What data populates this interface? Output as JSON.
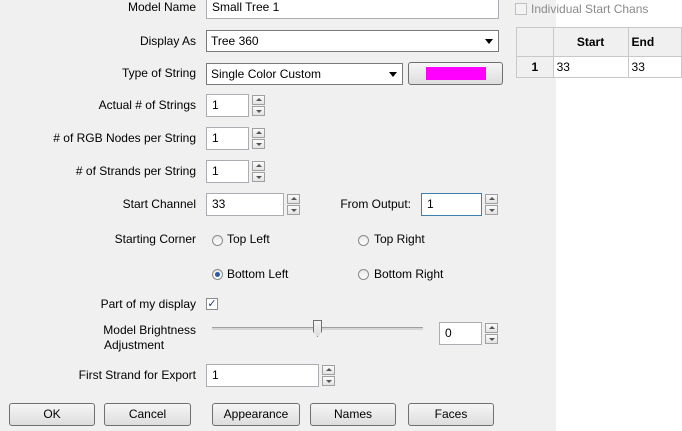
{
  "model_name": {
    "label": "Model Name",
    "value": "Small Tree 1"
  },
  "individual_start_chans": {
    "label": "Individual Start Chans",
    "checked": false,
    "enabled": false
  },
  "display_as": {
    "label": "Display As",
    "value": "Tree 360"
  },
  "type_of_string": {
    "label": "Type of String",
    "value": "Single Color Custom",
    "color": "#ff00ff"
  },
  "actual_strings": {
    "label": "Actual # of Strings",
    "value": "1"
  },
  "rgb_nodes": {
    "label": "# of RGB Nodes per String",
    "value": "1"
  },
  "strands": {
    "label": "# of Strands per String",
    "value": "1"
  },
  "start_channel": {
    "label": "Start Channel",
    "value": "33"
  },
  "from_output": {
    "label": "From Output:",
    "value": "1"
  },
  "starting_corner": {
    "label": "Starting Corner",
    "options": [
      "Top Left",
      "Top Right",
      "Bottom Left",
      "Bottom Right"
    ],
    "selected": "Bottom Left"
  },
  "part_of_display": {
    "label": "Part of my display",
    "checked": true
  },
  "brightness": {
    "label_line1": "Model Brightness",
    "label_line2": "Adjustment",
    "value": "0",
    "level_fraction": 0.5
  },
  "first_strand_export": {
    "label": "First Strand for Export",
    "value": "1"
  },
  "buttons": {
    "ok": "OK",
    "cancel": "Cancel",
    "appearance": "Appearance",
    "names": "Names",
    "faces": "Faces"
  },
  "grid": {
    "columns": [
      "Start",
      "End"
    ],
    "rows": [
      {
        "index": "1",
        "start": "33",
        "end": "33"
      }
    ]
  }
}
